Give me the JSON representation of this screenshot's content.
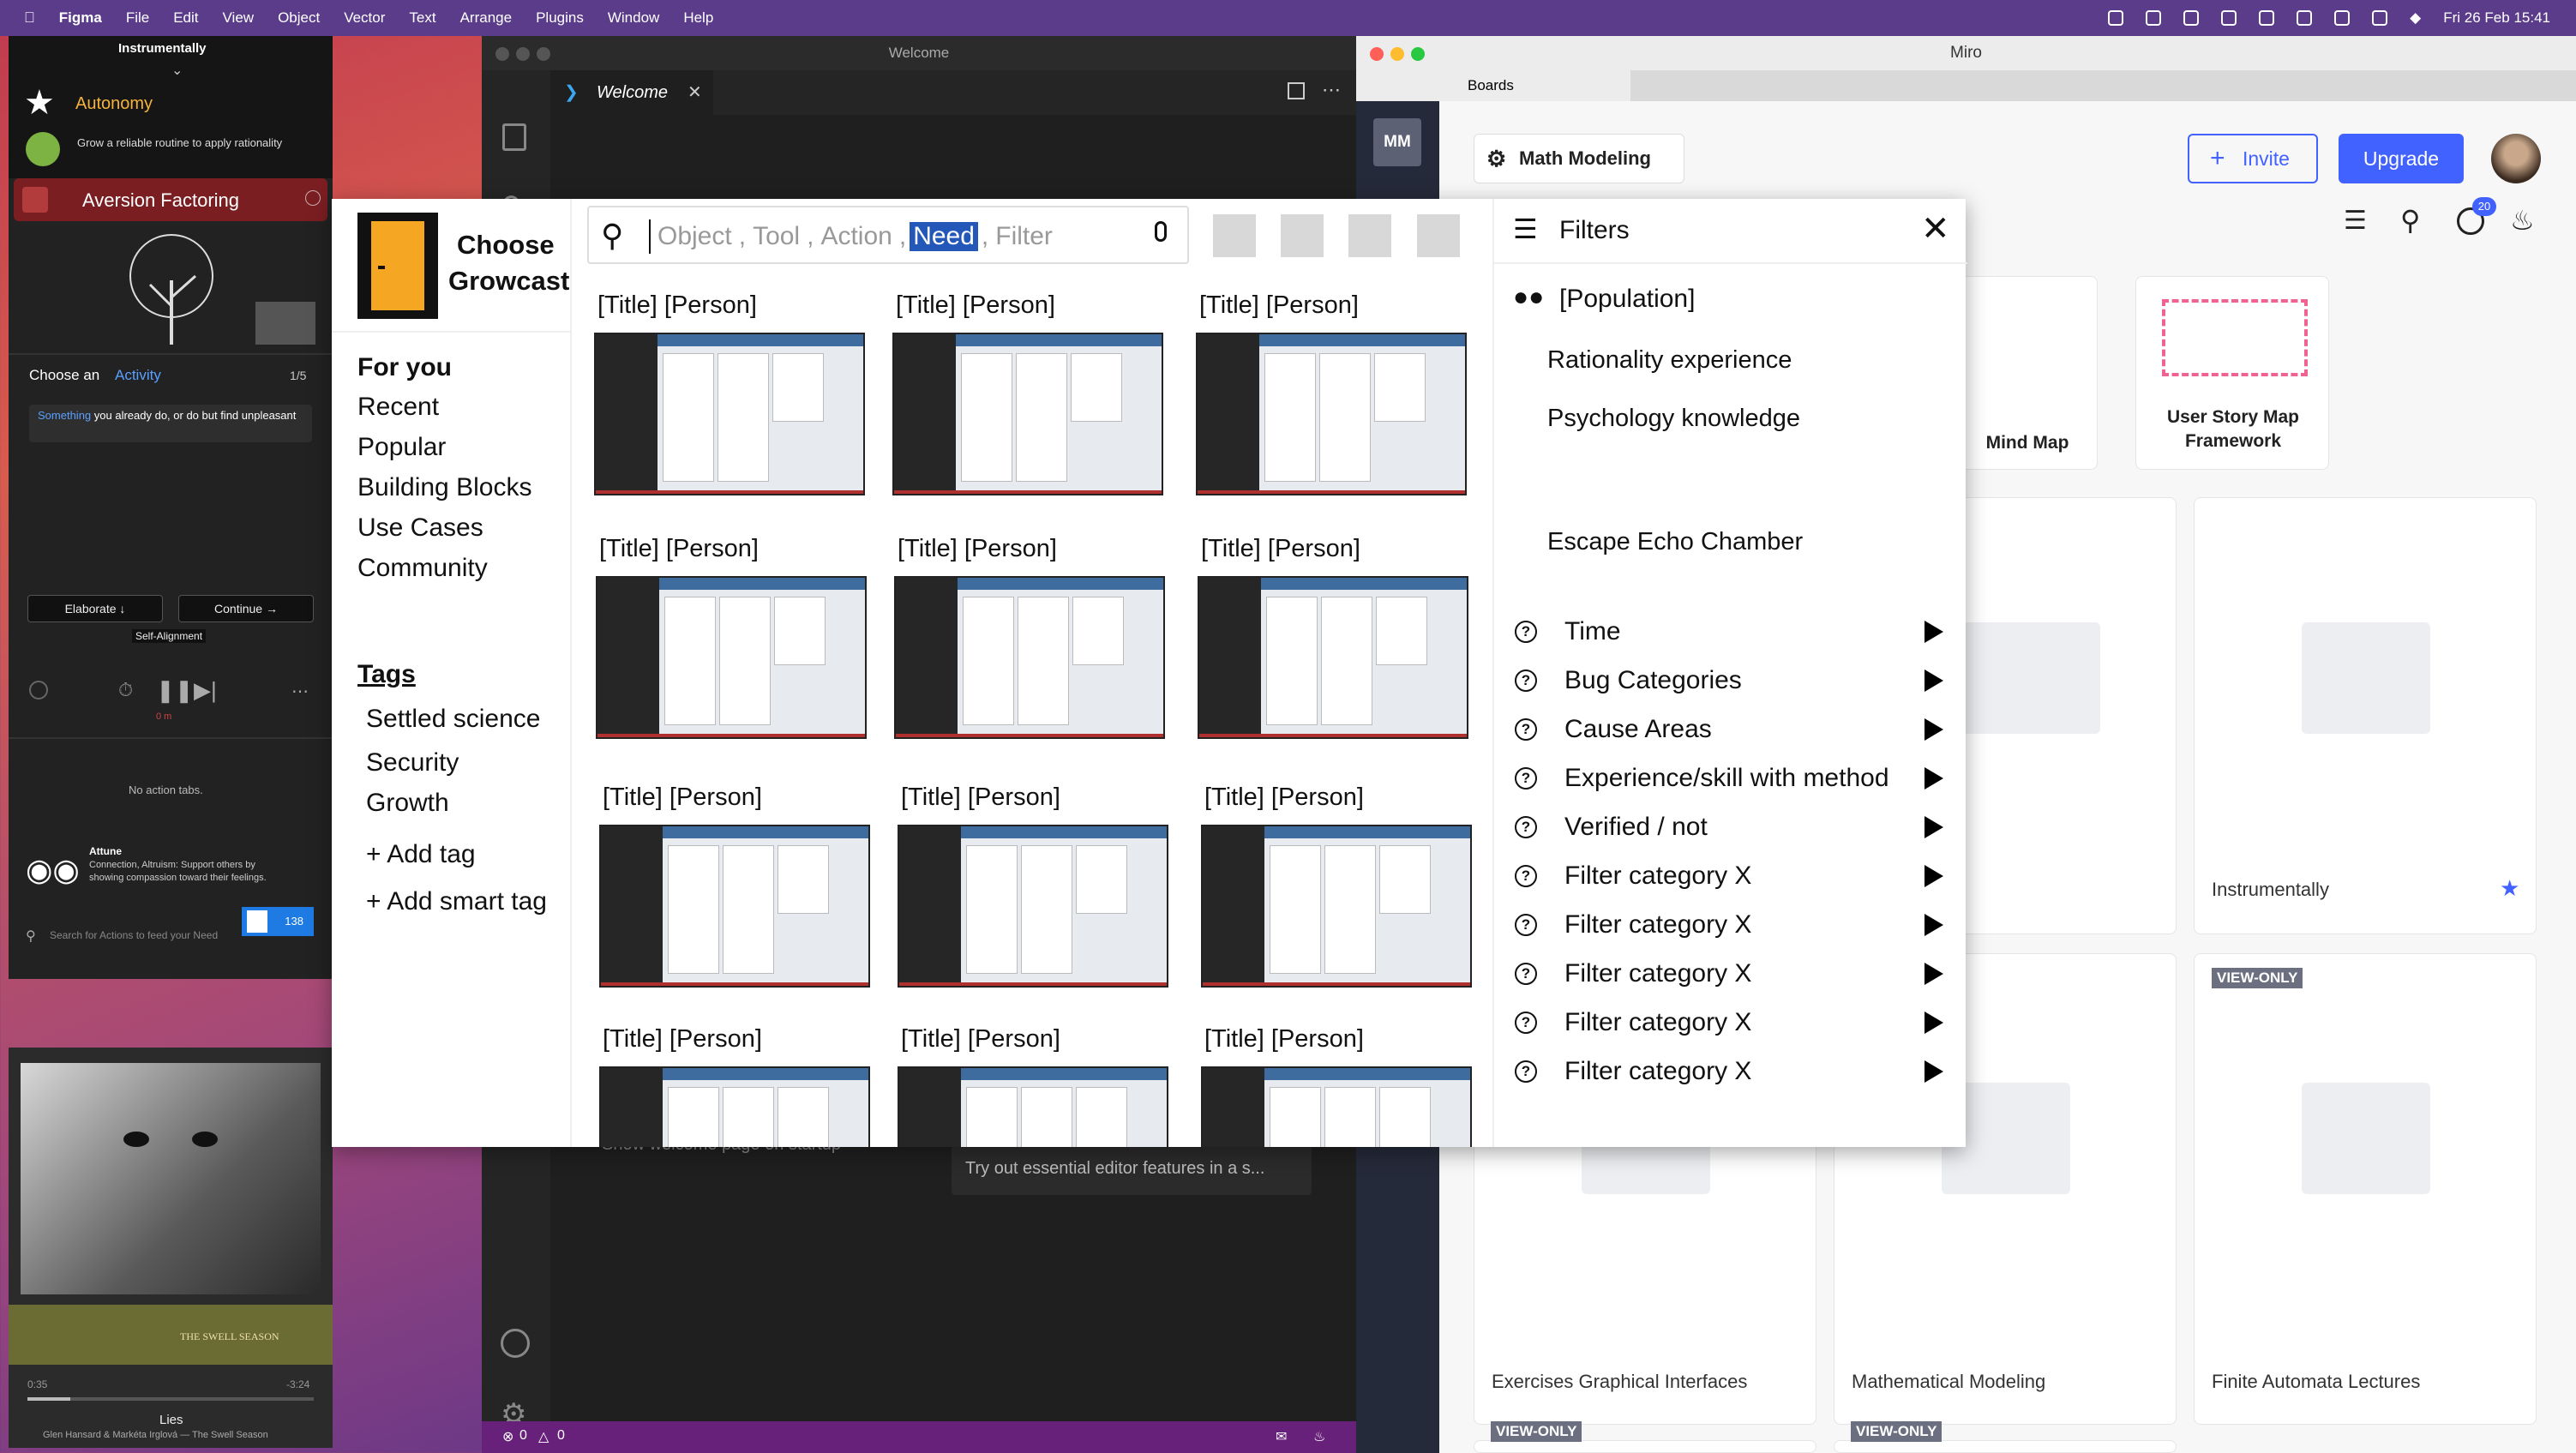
{
  "menubar": {
    "app": "Figma",
    "items": [
      "File",
      "Edit",
      "View",
      "Object",
      "Vector",
      "Text",
      "Arrange",
      "Plugins",
      "Window",
      "Help"
    ],
    "clock": "Fri 26 Feb  15:41"
  },
  "figma_panel": {
    "header": "Instrumentally",
    "autonomy": "Autonomy",
    "routine": "Grow a reliable routine to apply rationality",
    "aversion": "Aversion Factoring",
    "choose_prefix": "Choose an",
    "choose_link": "Activity",
    "pager": "1/5",
    "prompt_highlight": "Something",
    "prompt_rest": " you already do, or do but find unpleasant",
    "elaborate": "Elaborate",
    "continue": "Continue",
    "self_alignment": "Self-Alignment",
    "time_small": "0 m",
    "no_action": "No action tabs.",
    "attune_title": "Attune",
    "attune_desc": "Connection, Altruism: Support others by showing compassion toward their feelings.",
    "search_placeholder": "Search for Actions to feed your Need",
    "badge": "138"
  },
  "music": {
    "elapsed": "0:35",
    "remaining": "-3:24",
    "progress": 0.15,
    "track": "Lies",
    "artist": "Glen Hansard & Markéta Irglová — The Swell Season",
    "album_text": "THE SWELL SEASON"
  },
  "vscode": {
    "title": "Welcome",
    "tab": "Welcome",
    "bg_text1": "Show welcome page on startup",
    "bg_text2": "Try out essential editor features in a s...",
    "errors": "0",
    "warnings": "0"
  },
  "miro": {
    "title": "Miro",
    "boards_tab": "Boards",
    "avatar_initials": "MM",
    "board_name": "Math Modeling",
    "invite": "Invite",
    "upgrade": "Upgrade",
    "notif_count": "20",
    "templates": [
      "Mind Map",
      "User Story Map Framework"
    ],
    "boards": [
      "Instrumentally",
      "Exercises Graphical Interfaces",
      "Mathematical Modeling",
      "Finite Automata Lectures"
    ],
    "view_only": "VIEW-ONLY"
  },
  "growcast": {
    "logo_line1": "Choose",
    "logo_line2": "Growcast",
    "search_chips": [
      "Object",
      "Tool",
      "Action",
      "Need",
      "Filter"
    ],
    "nav": [
      "For you",
      "Recent",
      "Popular",
      "Building Blocks",
      "Use Cases",
      "Community"
    ],
    "tags_heading": "Tags",
    "tags": [
      "Settled science",
      "Security",
      "Growth"
    ],
    "add_tag": "+ Add tag",
    "add_smart_tag": "+ Add smart tag",
    "card_title": "[Title] [Person]",
    "filters_title": "Filters",
    "population": "[Population]",
    "population_items": [
      "Rationality experience",
      "Psychology knowledge",
      "Escape Echo Chamber"
    ],
    "filter_categories": [
      "Time",
      "Bug Categories",
      "Cause Areas",
      "Experience/skill with method",
      "Verified / not",
      "Filter category X",
      "Filter category X",
      "Filter category X",
      "Filter category X",
      "Filter category X"
    ]
  }
}
